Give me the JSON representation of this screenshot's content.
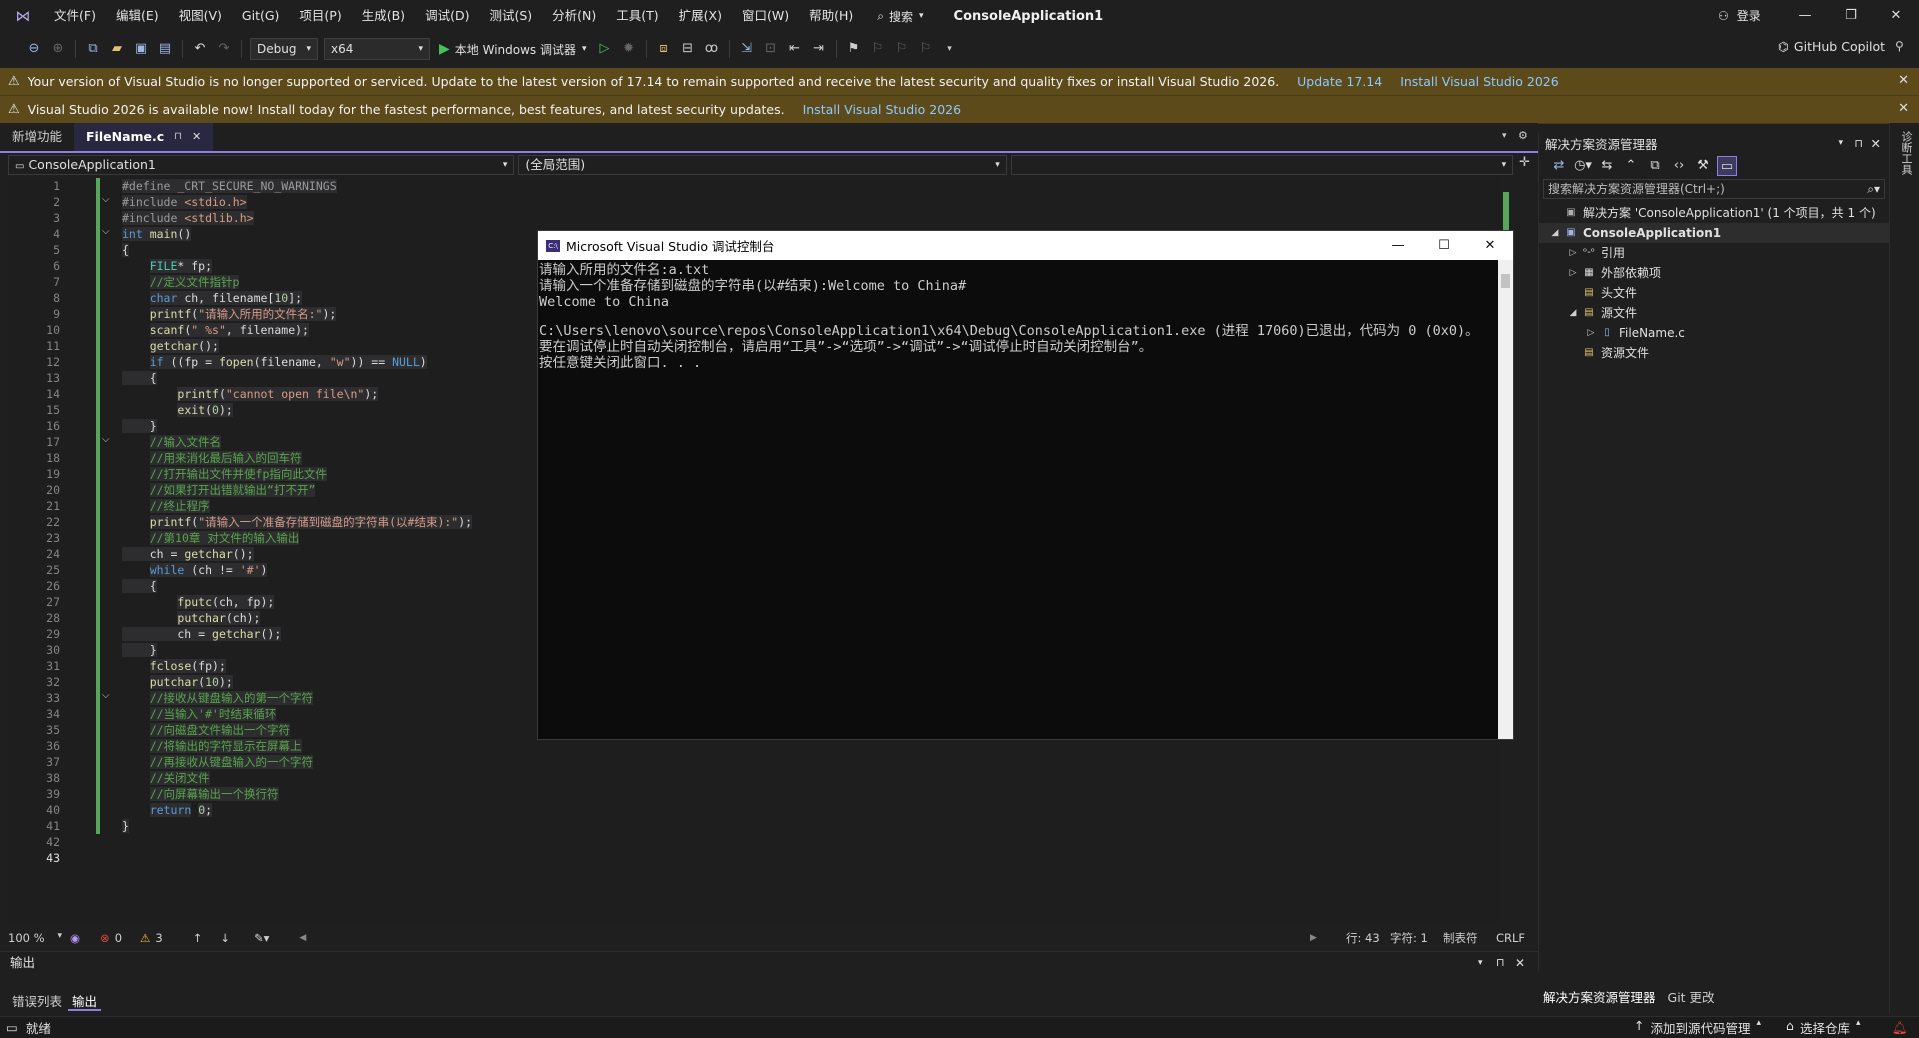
{
  "menubar": {
    "items": [
      "文件(F)",
      "编辑(E)",
      "视图(V)",
      "Git(G)",
      "项目(P)",
      "生成(B)",
      "调试(D)",
      "测试(S)",
      "分析(N)",
      "工具(T)",
      "扩展(X)",
      "窗口(W)",
      "帮助(H)"
    ],
    "search": "搜索",
    "project_title": "ConsoleApplication1",
    "login": "登录"
  },
  "toolbar": {
    "config": "Debug",
    "platform": "x64",
    "run_label": "本地 Windows 调试器",
    "copilot": "GitHub Copilot"
  },
  "infobar1": {
    "text": "Your version of Visual Studio is no longer supported or serviced. Update to the latest version of 17.14 to remain supported and receive the latest security and quality fixes or install Visual Studio 2026.",
    "link1": "Update 17.14",
    "link2": "Install Visual Studio 2026"
  },
  "infobar2": {
    "text": "Visual Studio 2026 is available now! Install today for the fastest performance, best features, and latest security updates.",
    "link1": "Install Visual Studio 2026"
  },
  "tabs": {
    "new_features": "新增功能",
    "active": "FileName.c",
    "pin": "⊓",
    "close": "✕"
  },
  "navbar": {
    "project": "ConsoleApplication1",
    "scope": "(全局范围)"
  },
  "editor": {
    "line_numbers": [
      "1",
      "2",
      "3",
      "4",
      "5",
      "6",
      "7",
      "8",
      "9",
      "10",
      "11",
      "12",
      "13",
      "14",
      "15",
      "16",
      "17",
      "18",
      "19",
      "20",
      "21",
      "22",
      "23",
      "24",
      "25",
      "26",
      "27",
      "28",
      "29",
      "30",
      "31",
      "32",
      "33",
      "34",
      "35",
      "36",
      "37",
      "38",
      "39",
      "40",
      "41",
      "42",
      "43"
    ],
    "lines": [
      [
        {
          "c": "pp",
          "t": "#define _CRT_SECURE_NO_WARNINGS"
        }
      ],
      [
        {
          "c": "pp",
          "t": "#include "
        },
        {
          "c": "st",
          "t": "<stdio.h>"
        }
      ],
      [
        {
          "c": "pp",
          "t": "#include "
        },
        {
          "c": "st",
          "t": "<stdlib.h>"
        }
      ],
      [
        {
          "c": "kw",
          "t": "int "
        },
        {
          "c": "fn",
          "t": "main"
        },
        {
          "c": "tx",
          "t": "()"
        }
      ],
      [
        {
          "c": "tx",
          "t": "{"
        }
      ],
      [
        {
          "c": "tx",
          "t": "    "
        },
        {
          "c": "ty",
          "t": "FILE"
        },
        {
          "c": "tx",
          "t": "* fp;"
        }
      ],
      [
        {
          "c": "tx",
          "t": "    "
        },
        {
          "c": "cm",
          "t": "//定义文件指针p"
        }
      ],
      [
        {
          "c": "tx",
          "t": "    "
        },
        {
          "c": "kw",
          "t": "char"
        },
        {
          "c": "tx",
          "t": " ch, filename["
        },
        {
          "c": "nu",
          "t": "10"
        },
        {
          "c": "tx",
          "t": "];"
        }
      ],
      [
        {
          "c": "tx",
          "t": "    "
        },
        {
          "c": "fn",
          "t": "printf"
        },
        {
          "c": "tx",
          "t": "("
        },
        {
          "c": "st",
          "t": "\"请输入所用的文件名:\""
        },
        {
          "c": "tx",
          "t": ");"
        }
      ],
      [
        {
          "c": "tx",
          "t": "    "
        },
        {
          "c": "fn",
          "t": "scanf"
        },
        {
          "c": "tx",
          "t": "("
        },
        {
          "c": "st",
          "t": "\" %s\""
        },
        {
          "c": "tx",
          "t": ", filename);"
        }
      ],
      [
        {
          "c": "tx",
          "t": "    "
        },
        {
          "c": "fn",
          "t": "getchar"
        },
        {
          "c": "tx",
          "t": "();"
        }
      ],
      [
        {
          "c": "tx",
          "t": "    "
        },
        {
          "c": "kw",
          "t": "if"
        },
        {
          "c": "tx",
          "t": " ((fp = "
        },
        {
          "c": "fn",
          "t": "fopen"
        },
        {
          "c": "tx",
          "t": "(filename, "
        },
        {
          "c": "st",
          "t": "\"w\""
        },
        {
          "c": "tx",
          "t": ")) == "
        },
        {
          "c": "kw",
          "t": "NULL"
        },
        {
          "c": "tx",
          "t": ")"
        }
      ],
      [
        {
          "c": "tx",
          "t": "    {"
        }
      ],
      [
        {
          "c": "tx",
          "t": "        "
        },
        {
          "c": "fn",
          "t": "printf"
        },
        {
          "c": "tx",
          "t": "("
        },
        {
          "c": "st",
          "t": "\"cannot open file\\n\""
        },
        {
          "c": "tx",
          "t": ");"
        }
      ],
      [
        {
          "c": "tx",
          "t": "        "
        },
        {
          "c": "fn",
          "t": "exit"
        },
        {
          "c": "tx",
          "t": "("
        },
        {
          "c": "nu",
          "t": "0"
        },
        {
          "c": "tx",
          "t": ");"
        }
      ],
      [
        {
          "c": "tx",
          "t": "    }"
        }
      ],
      [
        {
          "c": "tx",
          "t": "    "
        },
        {
          "c": "cm",
          "t": "//输入文件名"
        }
      ],
      [
        {
          "c": "tx",
          "t": "    "
        },
        {
          "c": "cm",
          "t": "//用来消化最后输入的回车符"
        }
      ],
      [
        {
          "c": "tx",
          "t": "    "
        },
        {
          "c": "cm",
          "t": "//打开输出文件并使fp指向此文件"
        }
      ],
      [
        {
          "c": "tx",
          "t": "    "
        },
        {
          "c": "cm",
          "t": "//如果打开出错就输出“打不开”"
        }
      ],
      [
        {
          "c": "tx",
          "t": "    "
        },
        {
          "c": "cm",
          "t": "//终止程序"
        }
      ],
      [
        {
          "c": "tx",
          "t": "    "
        },
        {
          "c": "fn",
          "t": "printf"
        },
        {
          "c": "tx",
          "t": "("
        },
        {
          "c": "st",
          "t": "\"请输入一个准备存储到磁盘的字符串(以#结束):\""
        },
        {
          "c": "tx",
          "t": ");"
        }
      ],
      [
        {
          "c": "tx",
          "t": "    "
        },
        {
          "c": "cm",
          "t": "//第10章 对文件的输入输出"
        }
      ],
      [
        {
          "c": "tx",
          "t": "    ch = "
        },
        {
          "c": "fn",
          "t": "getchar"
        },
        {
          "c": "tx",
          "t": "();"
        }
      ],
      [
        {
          "c": "tx",
          "t": "    "
        },
        {
          "c": "kw",
          "t": "while"
        },
        {
          "c": "tx",
          "t": " (ch != "
        },
        {
          "c": "st",
          "t": "'#'"
        },
        {
          "c": "tx",
          "t": ")"
        }
      ],
      [
        {
          "c": "tx",
          "t": "    {"
        }
      ],
      [
        {
          "c": "tx",
          "t": "        "
        },
        {
          "c": "fn",
          "t": "fputc"
        },
        {
          "c": "tx",
          "t": "(ch, fp);"
        }
      ],
      [
        {
          "c": "tx",
          "t": "        "
        },
        {
          "c": "fn",
          "t": "putchar"
        },
        {
          "c": "tx",
          "t": "(ch);"
        }
      ],
      [
        {
          "c": "tx",
          "t": "        ch = "
        },
        {
          "c": "fn",
          "t": "getchar"
        },
        {
          "c": "tx",
          "t": "();"
        }
      ],
      [
        {
          "c": "tx",
          "t": "    }"
        }
      ],
      [
        {
          "c": "tx",
          "t": "    "
        },
        {
          "c": "fn",
          "t": "fclose"
        },
        {
          "c": "tx",
          "t": "(fp);"
        }
      ],
      [
        {
          "c": "tx",
          "t": "    "
        },
        {
          "c": "fn",
          "t": "putchar"
        },
        {
          "c": "tx",
          "t": "("
        },
        {
          "c": "nu",
          "t": "10"
        },
        {
          "c": "tx",
          "t": ");"
        }
      ],
      [
        {
          "c": "tx",
          "t": "    "
        },
        {
          "c": "cm",
          "t": "//接收从键盘输入的第一个字符"
        }
      ],
      [
        {
          "c": "tx",
          "t": "    "
        },
        {
          "c": "cm",
          "t": "//当输入'#'时结束循环"
        }
      ],
      [
        {
          "c": "tx",
          "t": "    "
        },
        {
          "c": "cm",
          "t": "//向磁盘文件输出一个字符"
        }
      ],
      [
        {
          "c": "tx",
          "t": "    "
        },
        {
          "c": "cm",
          "t": "//将输出的字符显示在屏幕上"
        }
      ],
      [
        {
          "c": "tx",
          "t": "    "
        },
        {
          "c": "cm",
          "t": "//再接收从键盘输入的一个字符"
        }
      ],
      [
        {
          "c": "tx",
          "t": "    "
        },
        {
          "c": "cm",
          "t": "//关闭文件"
        }
      ],
      [
        {
          "c": "tx",
          "t": "    "
        },
        {
          "c": "cm",
          "t": "//向屏幕输出一个换行符"
        }
      ],
      [
        {
          "c": "tx",
          "t": "    "
        },
        {
          "c": "kw",
          "t": "return"
        },
        {
          "c": "tx",
          "t": " "
        },
        {
          "c": "nu",
          "t": "0"
        },
        {
          "c": "tx",
          "t": ";"
        }
      ],
      [
        {
          "c": "tx",
          "t": "}"
        }
      ],
      [
        {
          "c": "tx",
          "t": ""
        }
      ],
      [
        {
          "c": "tx",
          "t": ""
        }
      ]
    ]
  },
  "console": {
    "title": "Microsoft Visual Studio 调试控制台",
    "lines": [
      "请输入所用的文件名:a.txt",
      "请输入一个准备存储到磁盘的字符串(以#结束):Welcome to China#",
      "Welcome to China",
      "",
      "C:\\Users\\lenovo\\source\\repos\\ConsoleApplication1\\x64\\Debug\\ConsoleApplication1.exe (进程 17060)已退出，代码为 0 (0x0)。",
      "要在调试停止时自动关闭控制台，请启用“工具”->“选项”->“调试”->“调试停止时自动关闭控制台”。",
      "按任意键关闭此窗口. . ."
    ]
  },
  "editor_status": {
    "zoom": "100 %",
    "errors": "0",
    "warnings": "3",
    "line": "行: 43",
    "char": "字符: 1",
    "tabs": "制表符",
    "eol": "CRLF"
  },
  "solution_explorer": {
    "title": "解决方案资源管理器",
    "search_placeholder": "搜索解决方案资源管理器(Ctrl+;)",
    "solution": "解决方案 'ConsoleApplication1' (1 个项目，共 1 个)",
    "project": "ConsoleApplication1",
    "items": [
      "引用",
      "外部依赖项",
      "头文件",
      "源文件",
      "FileName.c",
      "资源文件"
    ],
    "bottom_tabs": [
      "解决方案资源管理器",
      "Git 更改"
    ]
  },
  "output_panel": {
    "title": "输出",
    "tabs": [
      "错误列表",
      "输出"
    ]
  },
  "statusbar": {
    "ready": "就绪",
    "add_source": "添加到源代码管理",
    "select_repo": "选择仓库"
  },
  "right_strip": "诊断工具"
}
